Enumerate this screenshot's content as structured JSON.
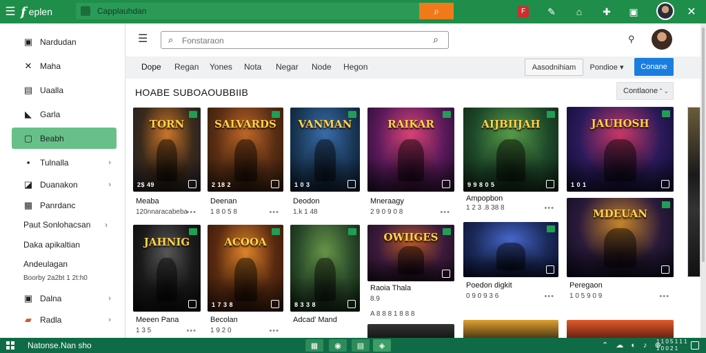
{
  "topbar": {
    "brand_logo": "f",
    "brand_name": "eplen",
    "search_text": "Capplauhdan",
    "search_go_icon": "search-icon",
    "icons": [
      "flag-icon",
      "chat-icon",
      "home-icon",
      "puzzle-icon",
      "hub-icon",
      "avatar",
      "close-icon"
    ],
    "flag_label": "F"
  },
  "sidebar": {
    "items": [
      {
        "label": "Nardudan",
        "icon": "hub-icon",
        "chevron": false
      },
      {
        "label": "Maha",
        "icon": "tools-icon",
        "chevron": false
      },
      {
        "label": "Uaalla",
        "icon": "info-icon",
        "chevron": false
      },
      {
        "label": "Garla",
        "icon": "cursor-icon",
        "chevron": false
      },
      {
        "label": "Beabh",
        "icon": "doc-icon",
        "chevron": false,
        "active": true
      },
      {
        "label": "Tulnalla",
        "icon": "box-icon",
        "chevron": true
      },
      {
        "label": "Duanakon",
        "icon": "chart-icon",
        "chevron": true
      },
      {
        "label": "Panrdanc",
        "icon": "grid-icon",
        "chevron": false
      }
    ],
    "plain_items": [
      {
        "label": "Paut Sonlohacsan",
        "chevron": true
      },
      {
        "label": "Daka apikaltian",
        "chevron": false
      },
      {
        "label": "Andeulagan",
        "chevron": false
      }
    ],
    "sub_text": "Boorby 2a2bt 1 2t:h0",
    "bottom_items": [
      {
        "label": "Dalna",
        "icon": "page-icon",
        "chevron": true
      },
      {
        "label": "Radla",
        "icon": "gift-icon",
        "chevron": true
      }
    ]
  },
  "main": {
    "search_placeholder": "Fonstaraon",
    "tabs": [
      "Dope",
      "Regan",
      "Yones",
      "Nota",
      "Negar",
      "Node",
      "Hegon"
    ],
    "active_tab": 0,
    "btn_add": "Aasodnihiam",
    "btn_filter": "Pondioe",
    "btn_primary": "Conane",
    "section_title": "HOABE SUBOAOUBBIIB",
    "sort_label": "Contlaone"
  },
  "cards": [
    {
      "title": "TORN",
      "name": "Meaba",
      "meta": "120nnaracabeba",
      "num": "2$ 49",
      "dots": true,
      "palette": [
        "#3b2a1a",
        "#d27a2c",
        "#1a1a2a"
      ]
    },
    {
      "title": "SALVARDS",
      "name": "Deenan",
      "meta": "1 8 0 5 8",
      "num": "2 18 2",
      "dots": true,
      "palette": [
        "#5a2e14",
        "#c46a28",
        "#2a1708"
      ]
    },
    {
      "title": "VANMAN",
      "name": "Deodon",
      "meta": "1.k 1 48",
      "num": "1 0 3",
      "dots": false,
      "palette": [
        "#1a3a5a",
        "#3b6fb0",
        "#0b1424"
      ]
    },
    {
      "title": "RAIKAR",
      "name": "Mneraagy",
      "meta": "2 9 0 9 0 8",
      "num": "",
      "dots": true,
      "palette": [
        "#5a1a5a",
        "#e0457a",
        "#1a0a24"
      ]
    },
    {
      "title": "AIJBIIJAH",
      "name": "Ampopbon",
      "meta": "1 2 3 .8 38 8",
      "num": "9 9 8 0 5",
      "dots": true,
      "palette": [
        "#1e4a2a",
        "#5aa04a",
        "#0d1a10"
      ]
    },
    {
      "title": "JAUHOSH",
      "name": "",
      "meta": "",
      "num": "1 0 1",
      "dots": false,
      "palette": [
        "#2a1a5a",
        "#d03a6a",
        "#0b0a24"
      ],
      "tall": true
    },
    {
      "title": "JAHNIG",
      "name": "Meeen Pana",
      "meta": "1 3 5",
      "num": "",
      "dots": true,
      "palette": [
        "#1a1a1a",
        "#5a5a5a",
        "#0a0a0a"
      ]
    },
    {
      "title": "ACOOA",
      "name": "Becolan",
      "meta": "1 9 2 0",
      "num": "1 7 3 8",
      "dots": true,
      "palette": [
        "#5a2a10",
        "#e58a2a",
        "#2a1408"
      ]
    },
    {
      "title": "",
      "name": "Adcad' Mand",
      "meta": "",
      "num": "8 3 3 8",
      "dots": false,
      "palette": [
        "#2a4a2a",
        "#6a9a4a",
        "#0a1a0a"
      ]
    },
    {
      "title": "OWIIGES",
      "name": "Raoia Thala",
      "meta": "8.9",
      "num": "",
      "dots": false,
      "palette": [
        "#3a1a3a",
        "#c05a2a",
        "#1a0a1a"
      ]
    },
    {
      "title": "",
      "name": "Poedon digkit",
      "meta": "0 9 0 9 3 6",
      "num": "",
      "dots": true,
      "palette": [
        "#1a2a5a",
        "#4a6ad0",
        "#0a0a24"
      ]
    },
    {
      "title": "MDEUAN",
      "name": "Peregaon",
      "meta": "1 0 5 9 0 9",
      "num": "",
      "dots": true,
      "palette": [
        "#2a1a3a",
        "#d08a2a",
        "#0a0a1a"
      ]
    }
  ],
  "extra_row": {
    "meta": "A 8 8 8 1 8 8 8"
  },
  "taskbar": {
    "title": "Natonse.Nan sho",
    "time": "1 1 0 5 1 1 1",
    "date": "1 0 0 2 1"
  }
}
